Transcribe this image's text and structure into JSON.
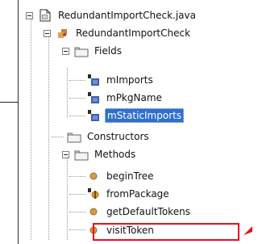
{
  "tree": {
    "file": {
      "label": "RedundantImportCheck.java",
      "icon": "java-file-icon"
    },
    "class": {
      "label": "RedundantImportCheck",
      "icon": "class-icon"
    },
    "fields_group": {
      "label": "Fields",
      "icon": "folder-icon"
    },
    "fields": [
      {
        "label": "mImports",
        "icon": "field-icon"
      },
      {
        "label": "mPkgName",
        "icon": "field-icon"
      },
      {
        "label": "mStaticImports",
        "icon": "field-icon",
        "selected": true
      }
    ],
    "constructors_group": {
      "label": "Constructors",
      "icon": "folder-icon"
    },
    "methods_group": {
      "label": "Methods",
      "icon": "folder-icon"
    },
    "methods": [
      {
        "label": "beginTree",
        "icon": "method-icon"
      },
      {
        "label": "fromPackage",
        "icon": "static-method-icon"
      },
      {
        "label": "getDefaultTokens",
        "icon": "method-icon"
      },
      {
        "label": "visitToken",
        "icon": "method-icon",
        "highlighted": true
      }
    ]
  },
  "colors": {
    "selection": "#2f6fcf",
    "highlight_box": "#e3131b",
    "method_dot": "#d89a45",
    "field_square": "#3f5fae"
  }
}
